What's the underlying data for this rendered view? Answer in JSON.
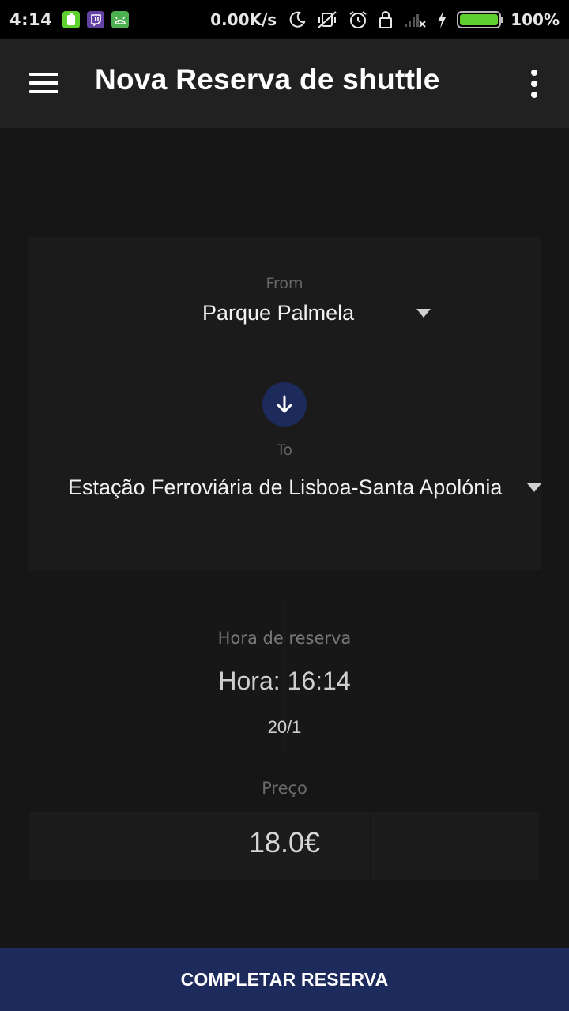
{
  "status_bar": {
    "time": "4:14",
    "network_speed": "0.00K/s",
    "battery_percent": "100%",
    "battery_level": 1.0,
    "notification_icons": [
      "battery-app-icon",
      "twitch-icon",
      "android-app-icon"
    ],
    "system_icons": [
      "moon-icon",
      "vibrate-off-icon",
      "alarm-icon",
      "lock-rotation-icon",
      "signal-off-icon",
      "charging-icon"
    ]
  },
  "app_bar": {
    "title": "Nova Reserva de shuttle",
    "menu_icon": "hamburger-menu-icon",
    "overflow_icon": "more-vert-icon"
  },
  "route": {
    "from_label": "From",
    "from_value": "Parque Palmela",
    "to_label": "To",
    "to_value": "Estação Ferroviária de Lisboa-Santa Apolónia",
    "swap_icon": "arrow-down-icon"
  },
  "booking_time": {
    "label": "Hora de reserva",
    "time": "Hora: 16:14",
    "date": "20/1"
  },
  "price": {
    "label": "Preço",
    "value": "18.0€"
  },
  "actions": {
    "complete_label": "COMPLETAR RESERVA"
  },
  "colors": {
    "primary": "#1d2a5c",
    "app_bar": "#212121",
    "background": "#161616",
    "battery": "#5fd12f"
  }
}
